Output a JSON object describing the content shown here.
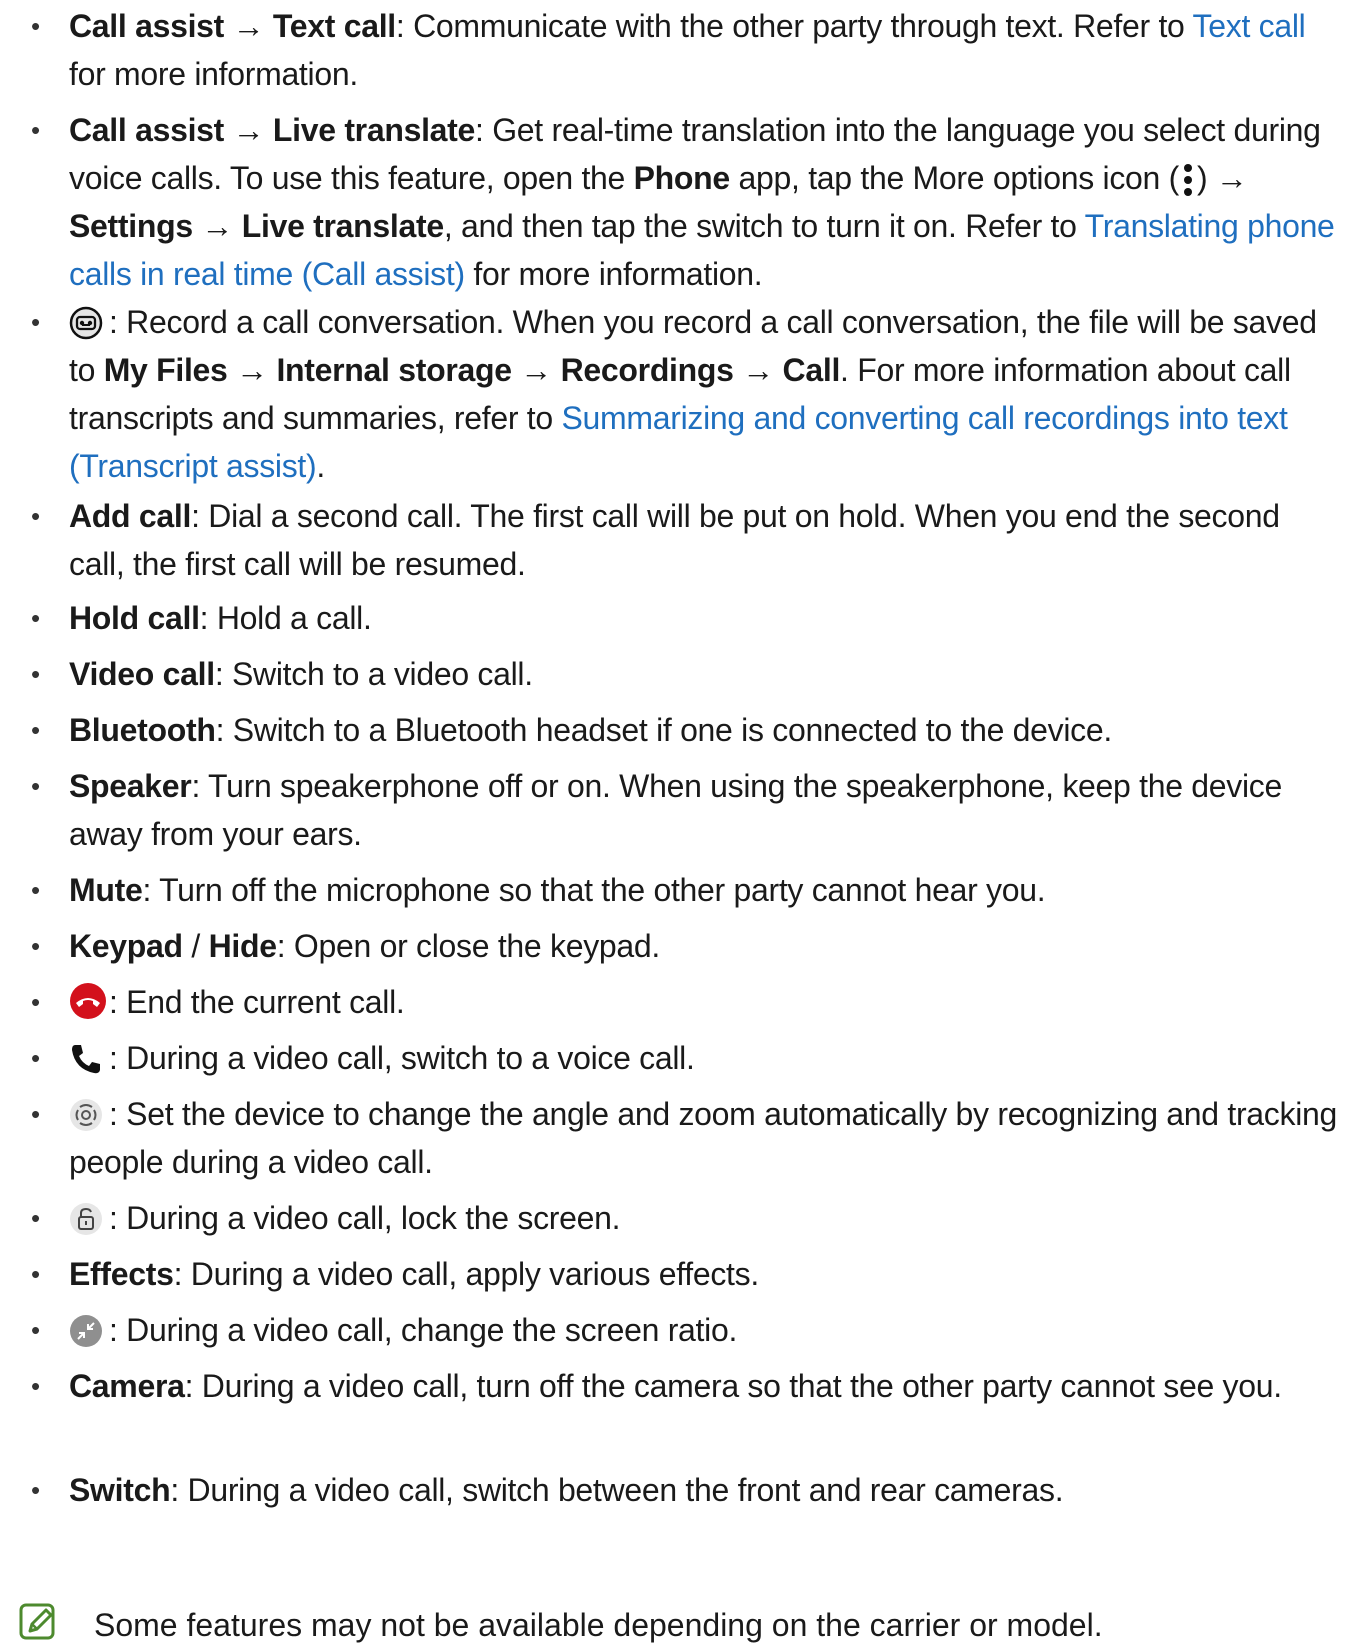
{
  "arrow": "→",
  "items": [
    {
      "segs": [
        {
          "t": "Call assist",
          "s": "b"
        },
        {
          "t": " → "
        },
        {
          "t": "Text call",
          "s": "b"
        },
        {
          "t": ": Communicate with the other party through text. Refer to "
        },
        {
          "t": "Text call",
          "s": "link"
        },
        {
          "t": " for more information."
        }
      ]
    },
    {
      "segs": [
        {
          "t": "Call assist",
          "s": "b"
        },
        {
          "t": " → "
        },
        {
          "t": "Live translate",
          "s": "b"
        },
        {
          "t": ": Get real-time translation into the language you select during voice calls. To use this feature, open the "
        },
        {
          "t": "Phone",
          "s": "b"
        },
        {
          "t": " app, tap the More options icon ("
        },
        {
          "t": "more-options-icon",
          "s": "icon"
        },
        {
          "t": ") → "
        },
        {
          "t": "Settings",
          "s": "b"
        },
        {
          "t": " → "
        },
        {
          "t": "Live translate",
          "s": "b"
        },
        {
          "t": ", and then tap the switch to turn it on. Refer to "
        },
        {
          "t": "Translating phone calls in real time (Call assist)",
          "s": "link"
        },
        {
          "t": " for more information."
        }
      ]
    },
    {
      "segs": [
        {
          "t": "record-icon",
          "s": "icon"
        },
        {
          "t": ": Record a call conversation. When you record a call conversation, the file will be saved to "
        },
        {
          "t": "My Files",
          "s": "b"
        },
        {
          "t": " → "
        },
        {
          "t": "Internal storage",
          "s": "b"
        },
        {
          "t": " → "
        },
        {
          "t": "Recordings",
          "s": "b"
        },
        {
          "t": " → "
        },
        {
          "t": "Call",
          "s": "b"
        },
        {
          "t": ". For more information about call transcripts and summaries, refer to "
        },
        {
          "t": "Summarizing and converting call recordings into text (Transcript assist)",
          "s": "link"
        },
        {
          "t": "."
        }
      ]
    },
    {
      "segs": [
        {
          "t": "Add call",
          "s": "b"
        },
        {
          "t": ": Dial a second call. The first call will be put on hold. When you end the second call, the first call will be resumed."
        }
      ]
    },
    {
      "segs": [
        {
          "t": "Hold call",
          "s": "b"
        },
        {
          "t": ": Hold a call."
        }
      ]
    },
    {
      "segs": [
        {
          "t": "Video call",
          "s": "b"
        },
        {
          "t": ": Switch to a video call."
        }
      ]
    },
    {
      "segs": [
        {
          "t": "Bluetooth",
          "s": "b"
        },
        {
          "t": ": Switch to a Bluetooth headset if one is connected to the device."
        }
      ]
    },
    {
      "segs": [
        {
          "t": "Speaker",
          "s": "b"
        },
        {
          "t": ": Turn speakerphone off or on. When using the speakerphone, keep the device away from your ears."
        }
      ]
    },
    {
      "segs": [
        {
          "t": "Mute",
          "s": "b"
        },
        {
          "t": ": Turn off the microphone so that the other party cannot hear you."
        }
      ]
    },
    {
      "segs": [
        {
          "t": "Keypad",
          "s": "b"
        },
        {
          "t": " / "
        },
        {
          "t": "Hide",
          "s": "b"
        },
        {
          "t": ": Open or close the keypad."
        }
      ]
    },
    {
      "segs": [
        {
          "t": "end-call-icon",
          "s": "icon"
        },
        {
          "t": ": End the current call."
        }
      ]
    },
    {
      "segs": [
        {
          "t": "voice-call-icon",
          "s": "icon"
        },
        {
          "t": ": During a video call, switch to a voice call."
        }
      ]
    },
    {
      "segs": [
        {
          "t": "auto-framing-icon",
          "s": "icon"
        },
        {
          "t": ": Set the device to change the angle and zoom automatically by recognizing and tracking people during a video call."
        }
      ]
    },
    {
      "segs": [
        {
          "t": "screen-lock-icon",
          "s": "icon"
        },
        {
          "t": ": During a video call, lock the screen."
        }
      ]
    },
    {
      "segs": [
        {
          "t": "Effects",
          "s": "b"
        },
        {
          "t": ": During a video call, apply various effects."
        }
      ]
    },
    {
      "segs": [
        {
          "t": "screen-ratio-icon",
          "s": "icon"
        },
        {
          "t": ": During a video call, change the screen ratio."
        }
      ]
    },
    {
      "segs": [
        {
          "t": "Camera",
          "s": "b"
        },
        {
          "t": ": During a video call, turn off the camera so that the other party cannot see you."
        }
      ]
    },
    {
      "segs": [
        {
          "t": "Switch",
          "s": "b"
        },
        {
          "t": ": During a video call, switch between the front and rear cameras."
        }
      ]
    }
  ],
  "note": {
    "icon": "note-pencil-icon",
    "text": "Some features may not be available depending on the carrier or model."
  },
  "colors": {
    "link": "#1f6fbf",
    "end_call": "#d3111c",
    "note_icon": "#4d8a2e"
  }
}
